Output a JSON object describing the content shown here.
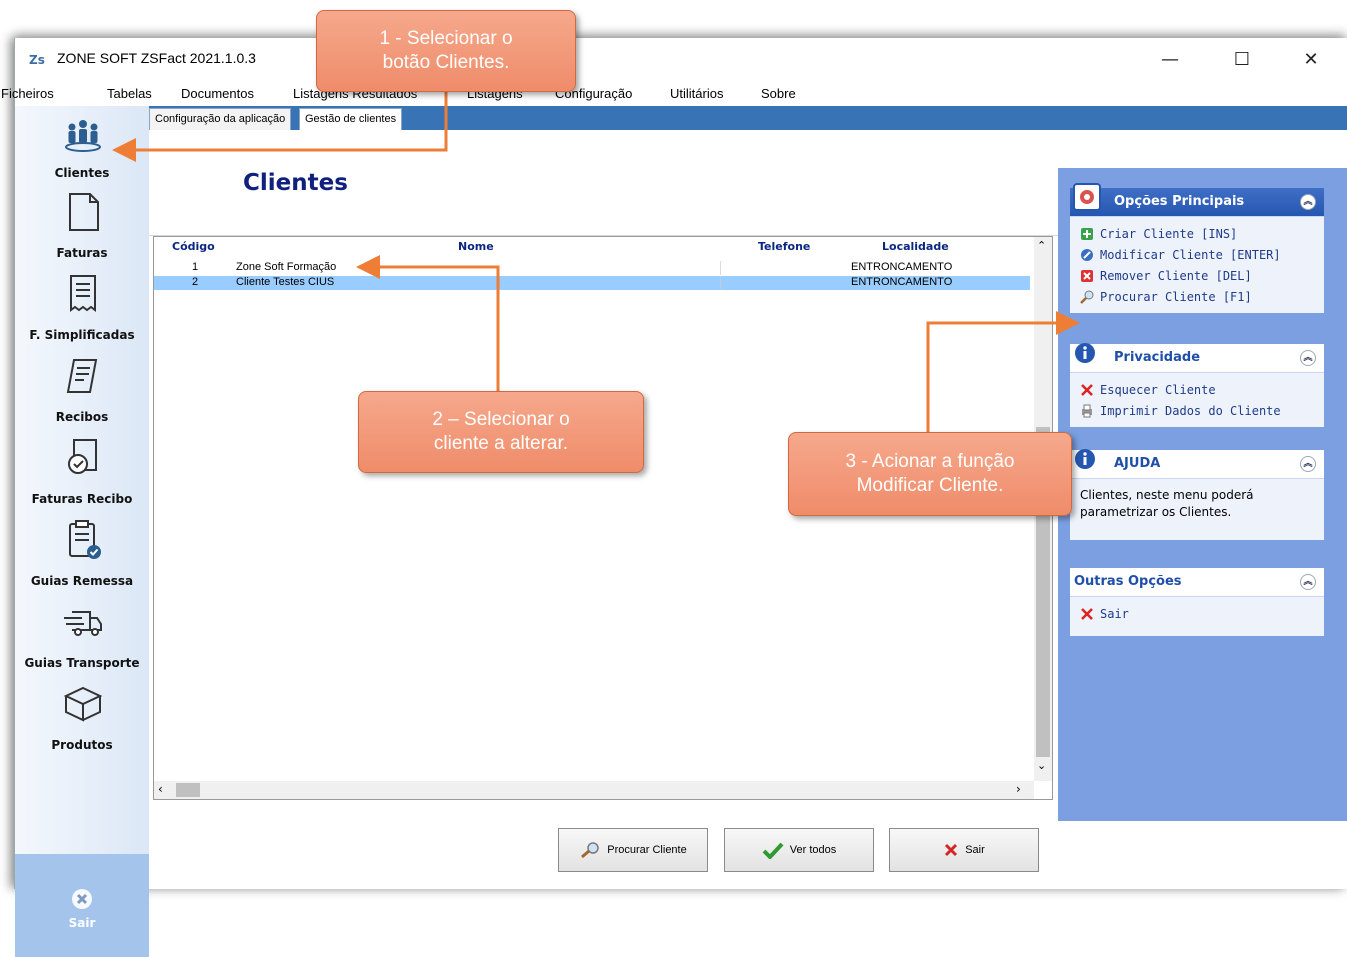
{
  "window": {
    "icon_text": "Zs",
    "title": "ZONE SOFT ZSFact 2021.1.0.3",
    "minimize": "—",
    "maximize": "☐",
    "close": "✕"
  },
  "menu": [
    "Ficheiros",
    "Tabelas",
    "Documentos",
    "Listagens Resultados",
    "Listagens",
    "Configuração",
    "Utilitários",
    "Sobre"
  ],
  "tabs": [
    "Configuração da aplicação",
    "Gestão de clientes"
  ],
  "sidebar": {
    "items": [
      {
        "label": "Clientes",
        "icon": "people-icon"
      },
      {
        "label": "Faturas",
        "icon": "document-icon"
      },
      {
        "label": "F. Simplificadas",
        "icon": "receipt-icon"
      },
      {
        "label": "Recibos",
        "icon": "pen-paper-icon"
      },
      {
        "label": "Faturas Recibo",
        "icon": "checked-doc-icon"
      },
      {
        "label": "Guias Remessa",
        "icon": "clipboard-check-icon"
      },
      {
        "label": "Guias Transporte",
        "icon": "truck-icon"
      },
      {
        "label": "Produtos",
        "icon": "box-icon"
      }
    ],
    "exit_label": "Sair"
  },
  "page": {
    "title": "Clientes"
  },
  "grid": {
    "columns": [
      "Código",
      "Nome",
      "Telefone",
      "Localidade"
    ],
    "rows": [
      {
        "codigo": "1",
        "nome": "Zone Soft Formação",
        "telefone": "",
        "localidade": "ENTRONCAMENTO"
      },
      {
        "codigo": "2",
        "nome": "Cliente Testes CIUS",
        "telefone": "",
        "localidade": "ENTRONCAMENTO"
      }
    ],
    "selected_row": 2,
    "selected_color": "#99ccff"
  },
  "buttons": {
    "search": "Procurar Cliente",
    "show_all": "Ver todos",
    "exit": "Sair"
  },
  "right_panel": {
    "main_options": {
      "title": "Opções Principais",
      "items": [
        {
          "label": "Criar Cliente [INS]",
          "icon": "add-icon"
        },
        {
          "label": "Modificar Cliente [ENTER]",
          "icon": "edit-icon"
        },
        {
          "label": "Remover Cliente [DEL]",
          "icon": "remove-icon"
        },
        {
          "label": "Procurar Cliente [F1]",
          "icon": "search-icon"
        }
      ]
    },
    "privacy": {
      "title": "Privacidade",
      "items": [
        {
          "label": "Esquecer Cliente",
          "icon": "x-icon"
        },
        {
          "label": "Imprimir Dados do Cliente",
          "icon": "print-icon"
        }
      ]
    },
    "help": {
      "title": "AJUDA",
      "text": "Clientes, neste menu poderá parametrizar os Clientes."
    },
    "other": {
      "title": "Outras Opções",
      "items": [
        {
          "label": "Sair",
          "icon": "x-icon"
        }
      ]
    }
  },
  "callouts": {
    "step1": "1 - Selecionar o botão Clientes.",
    "step2": "2 – Selecionar o cliente a alterar.",
    "step3": "3 - Acionar a função Modificar Cliente."
  },
  "colors": {
    "accent": "#3874b5",
    "callout": "#f19677",
    "arrow": "#ee7d36",
    "panel_bg": "#7b9fe0"
  }
}
